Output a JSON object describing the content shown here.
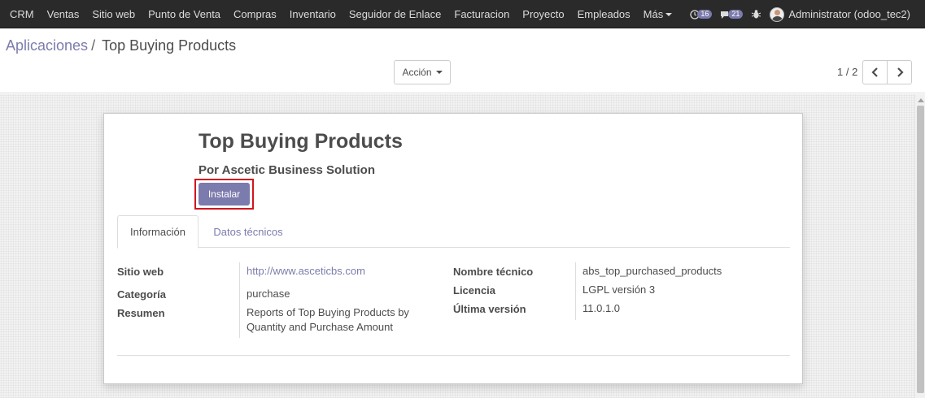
{
  "navbar": {
    "menu": [
      "CRM",
      "Ventas",
      "Sitio web",
      "Punto de Venta",
      "Compras",
      "Inventario",
      "Seguidor de Enlace",
      "Facturacion",
      "Proyecto",
      "Empleados"
    ],
    "more_label": "Más",
    "activity_count": "16",
    "message_count": "21",
    "user_name": "Administrator (odoo_tec2)"
  },
  "breadcrumb": {
    "parent": "Aplicaciones",
    "separator": "/",
    "current": "Top Buying Products"
  },
  "control_panel": {
    "action_label": "Acción",
    "pager": "1 / 2"
  },
  "module": {
    "title": "Top Buying Products",
    "author": "Por Ascetic Business Solution",
    "install_label": "Instalar",
    "tabs": [
      "Información",
      "Datos técnicos"
    ],
    "left_fields": {
      "website_label": "Sitio web",
      "website_value": "http://www.asceticbs.com",
      "category_label": "Categoría",
      "category_value": "purchase",
      "summary_label": "Resumen",
      "summary_line1": "Reports of Top Buying Products by",
      "summary_line2": "Quantity and Purchase Amount"
    },
    "right_fields": {
      "technical_name_label": "Nombre técnico",
      "technical_name_value": "abs_top_purchased_products",
      "license_label": "Licencia",
      "license_value": "LGPL versión 3",
      "latest_version_label": "Última versión",
      "latest_version_value": "11.0.1.0"
    }
  },
  "colors": {
    "navbar_bg": "#2a2a2a",
    "accent": "#7c7bad",
    "highlight_border": "#d2161e"
  }
}
